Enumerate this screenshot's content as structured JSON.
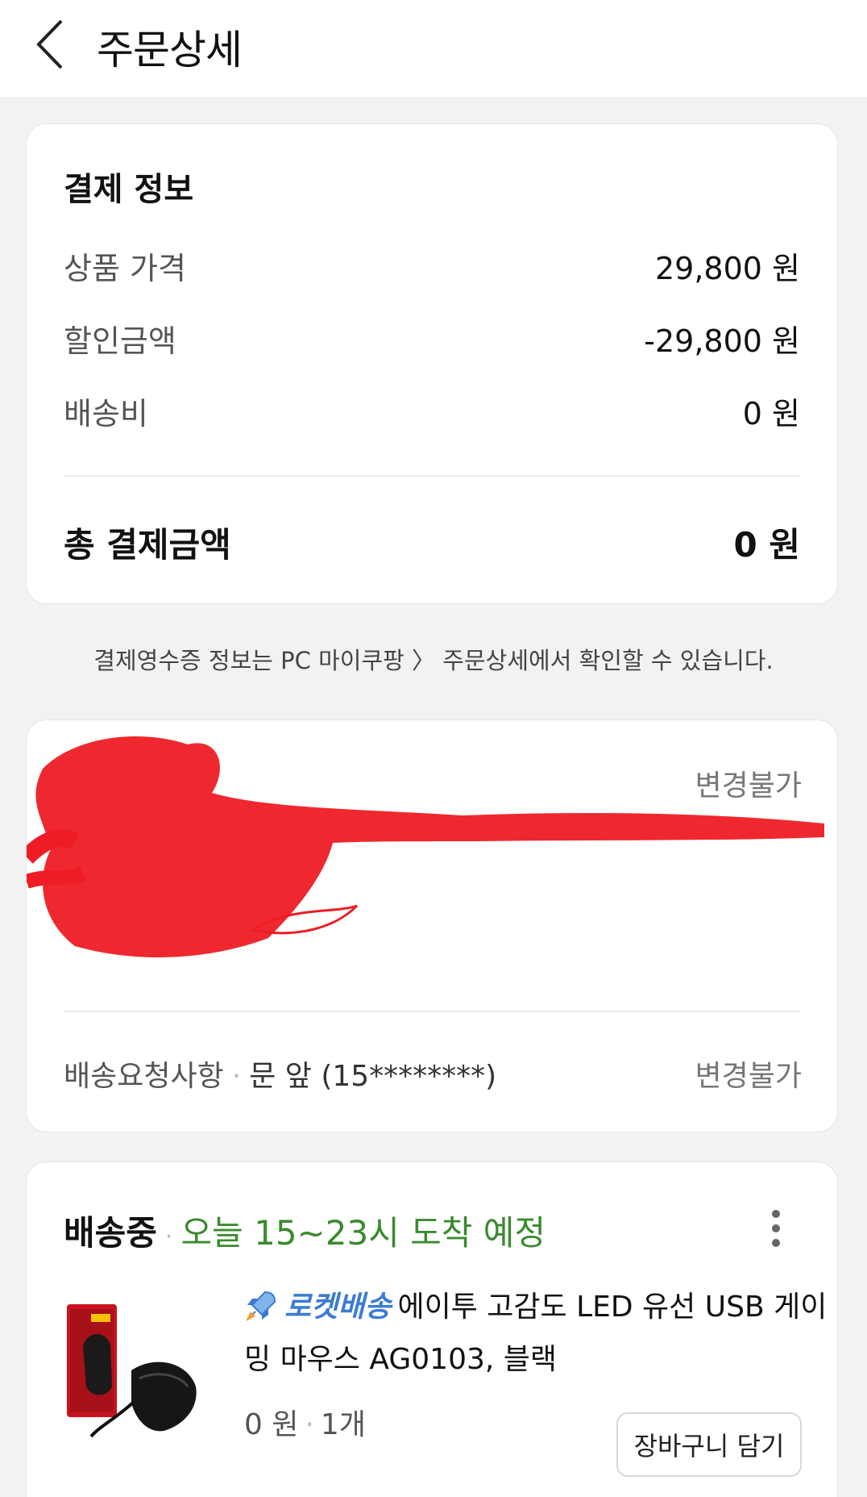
{
  "header": {
    "title": "주문상세"
  },
  "payment": {
    "title": "결제 정보",
    "rows": [
      {
        "label": "상품 가격",
        "value": "29,800 원"
      },
      {
        "label": "할인금액",
        "value": "-29,800 원"
      },
      {
        "label": "배송비",
        "value": "0 원"
      }
    ],
    "total": {
      "label": "총 결제금액",
      "value": "0 원"
    }
  },
  "notice": {
    "prefix": "결제영수증 정보는 PC 마이쿠팡",
    "suffix": "주문상세에서 확인할 수 있습니다."
  },
  "address": {
    "change_label": "변경불가",
    "request_label": "배송요청사항",
    "request_value": "문 앞 (15********)",
    "request_change_label": "변경불가"
  },
  "delivery": {
    "status": "배송중",
    "eta": "오늘 15~23시 도착 예정",
    "product": {
      "badge": "로켓배송",
      "name_line1": "에이투 고감도 LED 유선 USB 게이",
      "name_line2": "밍 마우스 AG0103, 블랙",
      "price": "0 원",
      "quantity": "1개",
      "cart_button": "장바구니 담기"
    }
  },
  "colors": {
    "eta_green": "#3a8a2e",
    "rocket_blue": "#3b7bd4",
    "redaction_red": "#ee1c24"
  },
  "icons": [
    "back-arrow-icon",
    "more-vertical-icon",
    "rocket-icon"
  ]
}
